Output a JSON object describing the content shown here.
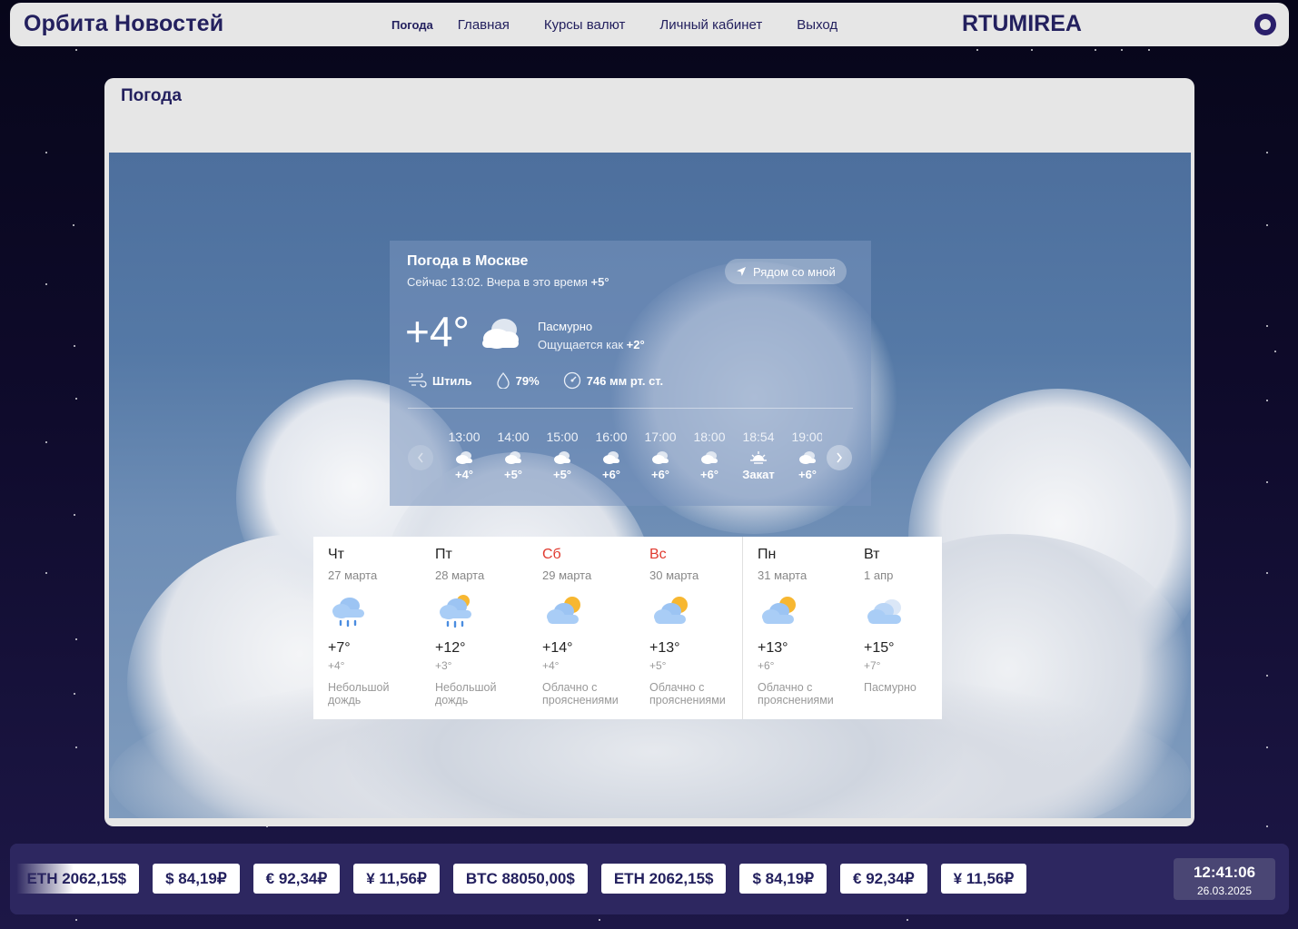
{
  "header": {
    "brand": "Орбита Новостей",
    "site_id": "RTUMIREA",
    "nav": [
      {
        "label": "Погода",
        "active": true
      },
      {
        "label": "Главная"
      },
      {
        "label": "Курсы валют"
      },
      {
        "label": "Личный кабинет"
      },
      {
        "label": "Выход"
      }
    ]
  },
  "page": {
    "title": "Погода"
  },
  "weather": {
    "title": "Погода в Москве",
    "subtitle_prefix": "Сейчас 13:02. Вчера в это время ",
    "subtitle_temp": "+5°",
    "nearby_label": "Рядом со мной",
    "temperature": "+4°",
    "condition": "Пасмурно",
    "feels_prefix": "Ощущается как ",
    "feels_value": "+2°",
    "wind": "Штиль",
    "humidity": "79%",
    "pressure": "746 мм рт. ст.",
    "hourly": [
      {
        "time": "13:00",
        "temp": "+4°",
        "icon": "cloudy-icon"
      },
      {
        "time": "14:00",
        "temp": "+5°",
        "icon": "cloudy-icon"
      },
      {
        "time": "15:00",
        "temp": "+5°",
        "icon": "cloudy-icon"
      },
      {
        "time": "16:00",
        "temp": "+6°",
        "icon": "cloudy-icon"
      },
      {
        "time": "17:00",
        "temp": "+6°",
        "icon": "cloudy-icon"
      },
      {
        "time": "18:00",
        "temp": "+6°",
        "icon": "cloudy-icon"
      },
      {
        "time": "18:54",
        "temp": "Закат",
        "icon": "sunset-icon"
      },
      {
        "time": "19:00",
        "temp": "+6°",
        "icon": "cloudy-icon"
      }
    ]
  },
  "forecast": [
    {
      "day": "Чт",
      "date": "27 марта",
      "hi": "+7°",
      "lo": "+4°",
      "desc": "Небольшой дождь",
      "icon": "rain-icon",
      "weekend": false
    },
    {
      "day": "Пт",
      "date": "28 марта",
      "hi": "+12°",
      "lo": "+3°",
      "desc": "Небольшой дождь",
      "icon": "rain-sun-icon",
      "weekend": false
    },
    {
      "day": "Сб",
      "date": "29 марта",
      "hi": "+14°",
      "lo": "+4°",
      "desc": "Облачно с прояснениями",
      "icon": "partly-cloudy-icon",
      "weekend": true
    },
    {
      "day": "Вс",
      "date": "30 марта",
      "hi": "+13°",
      "lo": "+5°",
      "desc": "Облачно с прояснениями",
      "icon": "partly-cloudy-icon",
      "weekend": true
    },
    {
      "day": "Пн",
      "date": "31 марта",
      "hi": "+13°",
      "lo": "+6°",
      "desc": "Облачно с прояснениями",
      "icon": "partly-cloudy-icon",
      "weekend": false
    },
    {
      "day": "Вт",
      "date": "1 апр",
      "hi": "+15°",
      "lo": "+7°",
      "desc": "Пасмурно",
      "icon": "overcast-icon",
      "weekend": false
    }
  ],
  "ticker": {
    "items": [
      "$",
      "ETH 2062,15$",
      "$ 84,19₽",
      "€ 92,34₽",
      "¥ 11,56₽",
      "BTC 88050,00$",
      "ETH 2062,15$",
      "$ 84,19₽",
      "€ 92,34₽",
      "¥ 11,56₽"
    ],
    "clock_time": "12:41:06",
    "clock_date": "26.03.2025"
  },
  "colors": {
    "brand": "#23205e",
    "weekend": "#e03a2f",
    "ticker_bg": "#2d2760"
  }
}
